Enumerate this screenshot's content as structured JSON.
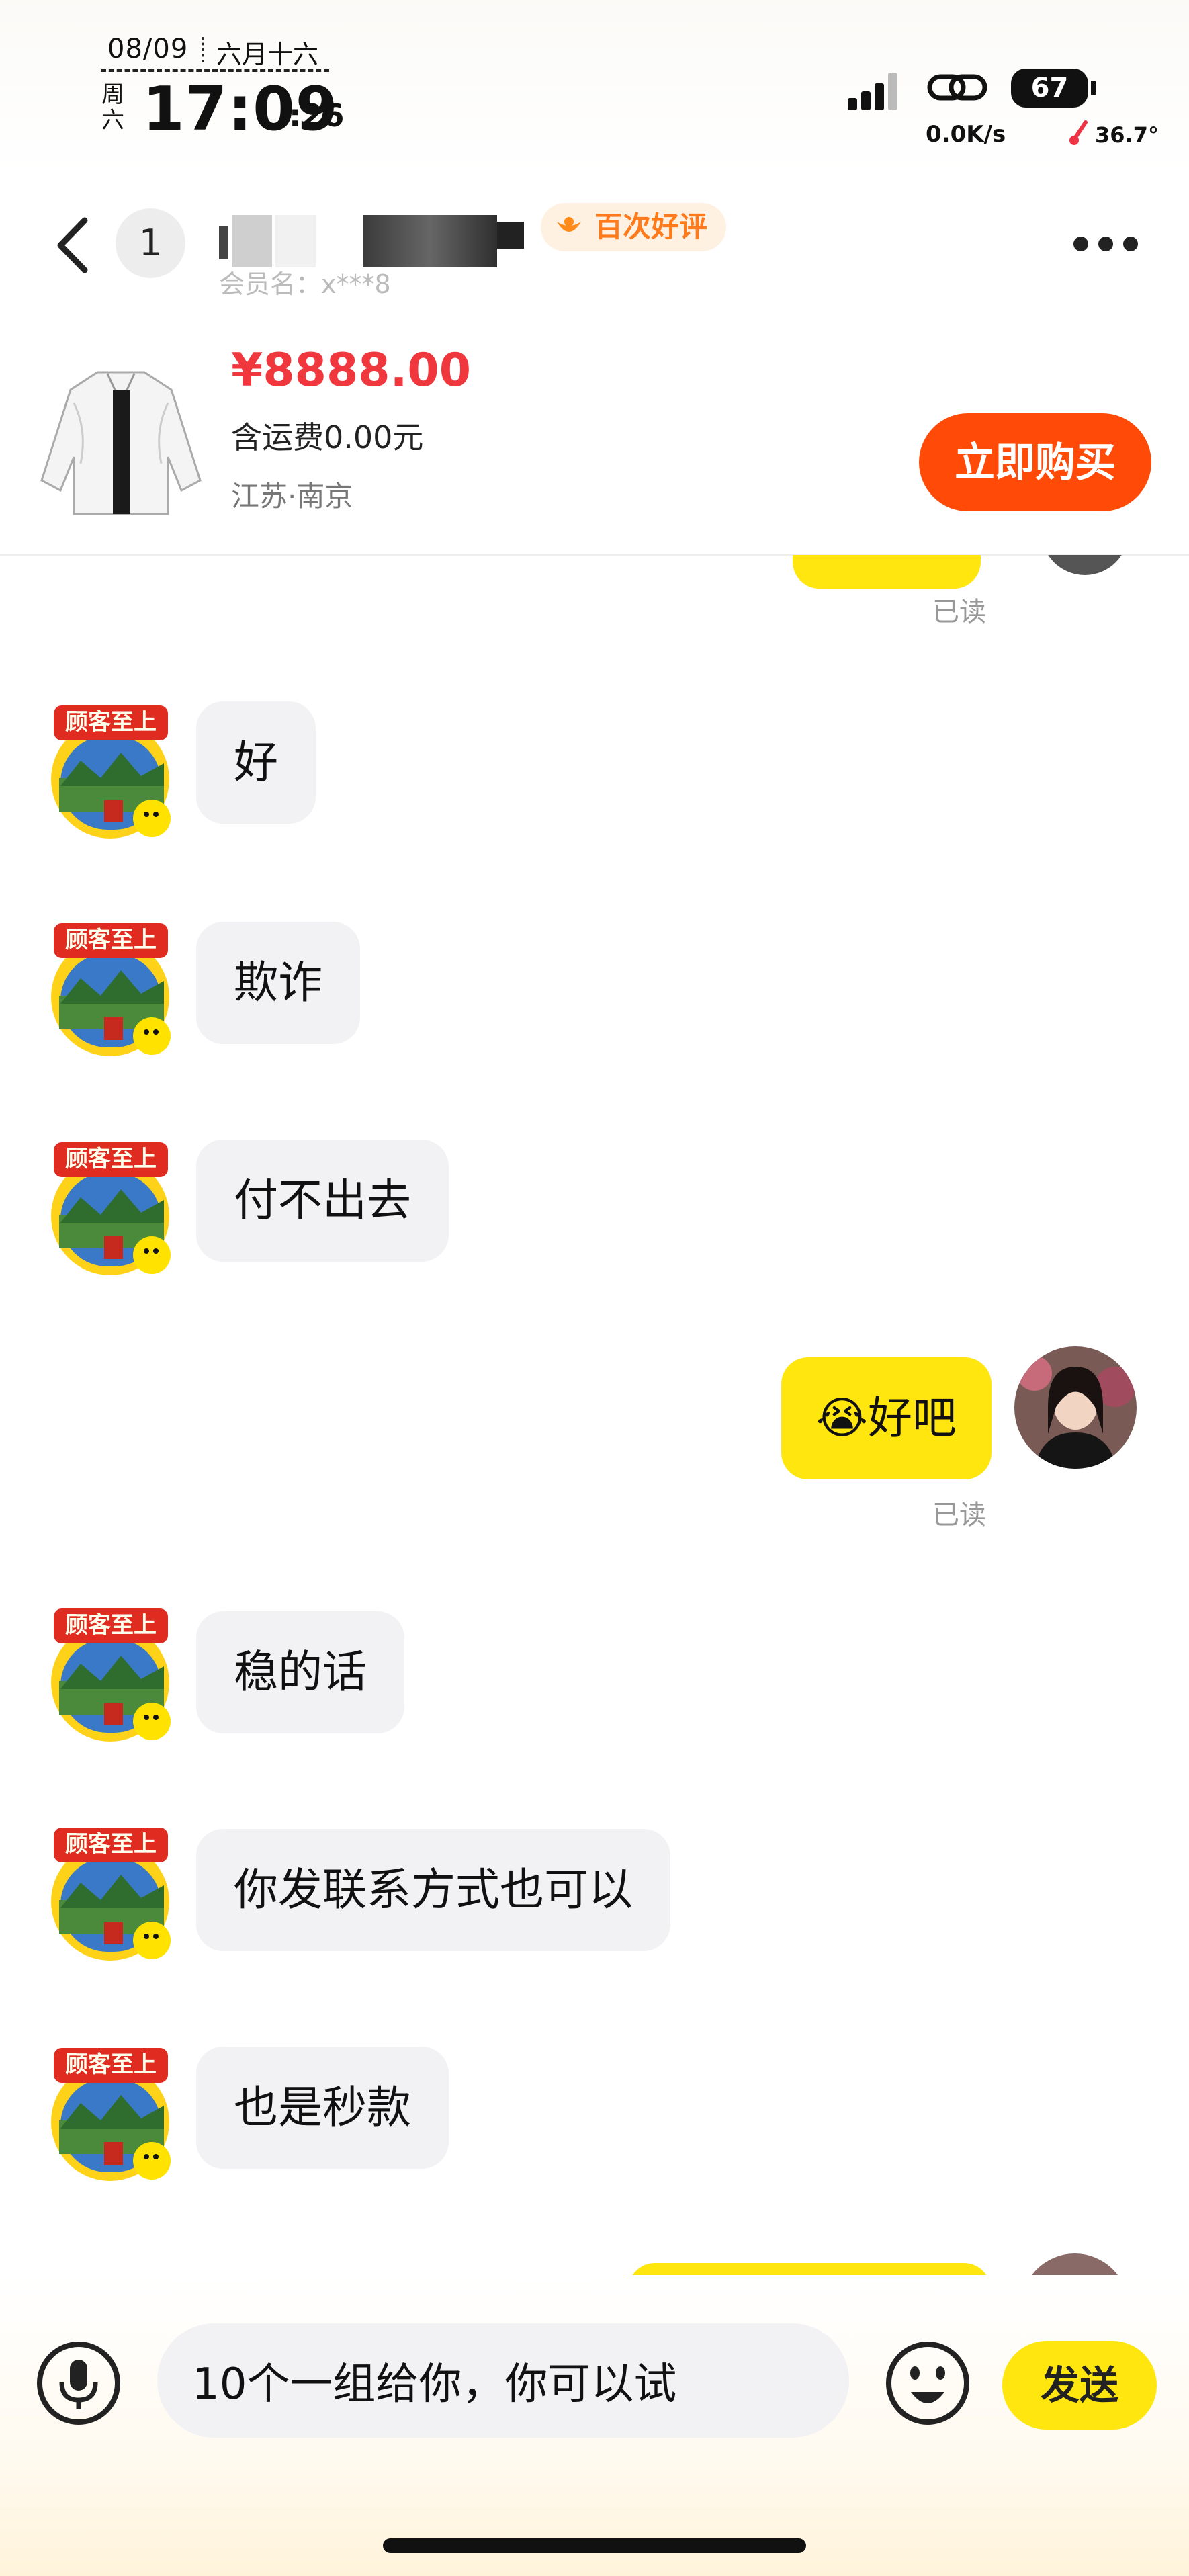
{
  "status_bar": {
    "date": "08/09",
    "lunar": "六月十六",
    "weekday": "周六",
    "time": "17:09",
    "seconds": ":26",
    "battery": "67",
    "net_speed": "0.0K/s",
    "temperature": "36.7°"
  },
  "header": {
    "unread_count": "1",
    "member": "会员名：x***8",
    "praise_badge": "百次好评",
    "back_icon": "chevron-left-icon",
    "more_icon": "more-dots-icon"
  },
  "product": {
    "price": "¥8888.00",
    "shipping": "含运费0.00元",
    "location": "江苏·南京",
    "buy_button": "立即购买"
  },
  "chat": {
    "read_label": "已读",
    "messages": [
      {
        "side": "left",
        "text": "好"
      },
      {
        "side": "left",
        "text": "欺诈"
      },
      {
        "side": "left",
        "text": "付不出去"
      },
      {
        "side": "right",
        "emoji": "😭",
        "text": "好吧"
      },
      {
        "side": "left",
        "text": "稳的话"
      },
      {
        "side": "left",
        "text": "你发联系方式也可以"
      },
      {
        "side": "left",
        "text": "也是秒款"
      }
    ],
    "seller_avatar_text": "顾客至上"
  },
  "input_bar": {
    "value": "10个一组给你，你可以试",
    "send_label": "发送"
  },
  "colors": {
    "accent_yellow": "#ffe60f",
    "buy_orange": "#ff4a08",
    "price_red": "#f0373d"
  }
}
